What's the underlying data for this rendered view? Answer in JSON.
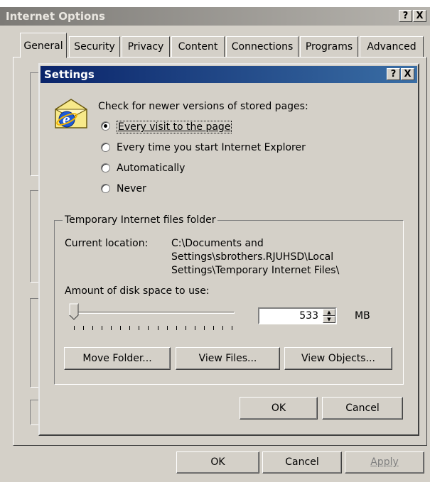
{
  "outer_dialog": {
    "title": "Internet Options",
    "help_label": "?",
    "close_label": "X",
    "tabs": [
      "General",
      "Security",
      "Privacy",
      "Content",
      "Connections",
      "Programs",
      "Advanced"
    ],
    "buttons": {
      "ok": "OK",
      "cancel": "Cancel",
      "apply": "Apply"
    }
  },
  "settings_dialog": {
    "title": "Settings",
    "help_label": "?",
    "close_label": "X",
    "check_label": "Check for newer versions of stored pages:",
    "options": [
      {
        "label": "Every visit to the page",
        "selected": true
      },
      {
        "label": "Every time you start Internet Explorer",
        "selected": false
      },
      {
        "label": "Automatically",
        "selected": false
      },
      {
        "label": "Never",
        "selected": false
      }
    ],
    "group": {
      "legend": "Temporary Internet files folder",
      "location_label": "Current location:",
      "location_lines": [
        "C:\\Documents and",
        "Settings\\sbrothers.RJUHSD\\Local",
        "Settings\\Temporary Internet Files\\"
      ],
      "disk_space_label": "Amount of disk space to use:",
      "disk_space_value": "533",
      "disk_space_unit": "MB",
      "slider_level": 0.05,
      "buttons": {
        "move": "Move Folder...",
        "view_files": "View Files...",
        "view_objects": "View Objects..."
      }
    },
    "buttons": {
      "ok": "OK",
      "cancel": "Cancel"
    }
  },
  "colors": {
    "title_active": "#0a246a",
    "title_inactive": "#7c7a76",
    "face": "#d4d0c8"
  }
}
